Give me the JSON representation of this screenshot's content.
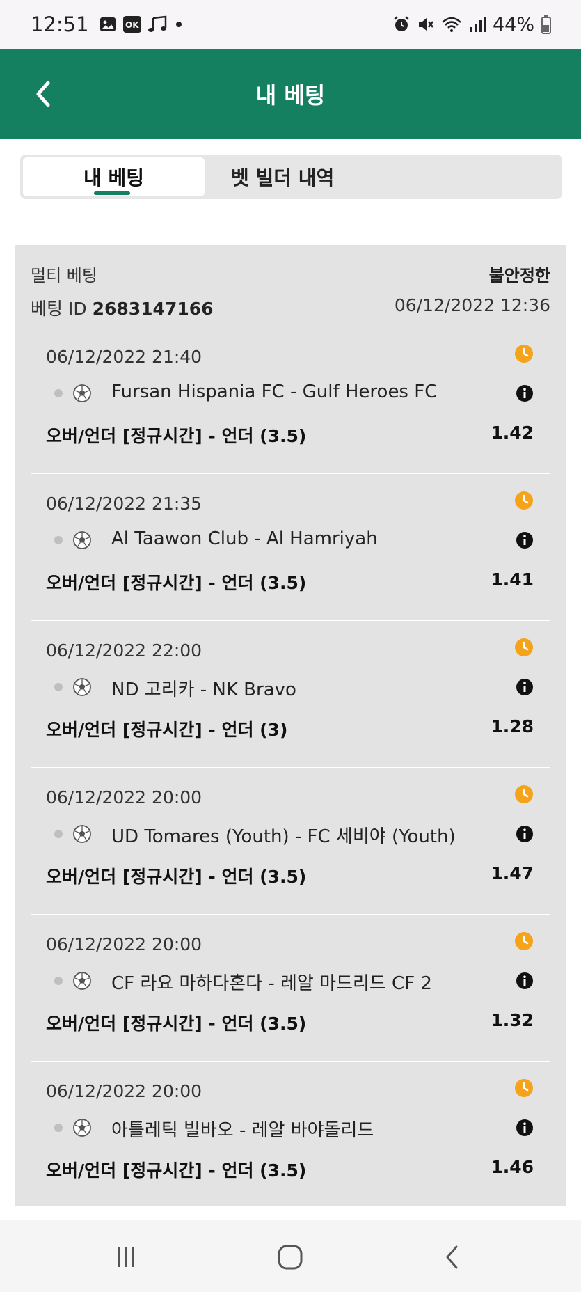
{
  "status_bar": {
    "time": "12:51",
    "left_icons": [
      "image-icon",
      "ok-app-icon",
      "music-icon",
      "dot-icon"
    ],
    "right_icons": [
      "alarm-icon",
      "mute-icon",
      "wifi-icon",
      "signal-icon",
      "battery-icon"
    ],
    "battery": "44%"
  },
  "header": {
    "title": "내 베팅",
    "back_icon": "chevron-left-icon"
  },
  "tabs": [
    {
      "label": "내 베팅",
      "active": true
    },
    {
      "label": "벳 빌더 내역",
      "active": false
    }
  ],
  "bet": {
    "type": "멀티 베팅",
    "status": "불안정한",
    "id_label": "베팅 ID",
    "id": "2683147166",
    "placed_at": "06/12/2022 12:36",
    "selections": [
      {
        "date": "06/12/2022 21:40",
        "match": "Fursan Hispania FC - Gulf Heroes FC",
        "market": "오버/언더 [정규시간] - 언더 (3.5)",
        "odds": "1.42"
      },
      {
        "date": "06/12/2022 21:35",
        "match": "Al Taawon Club - Al Hamriyah",
        "market": "오버/언더 [정규시간] - 언더 (3.5)",
        "odds": "1.41"
      },
      {
        "date": "06/12/2022 22:00",
        "match": "ND 고리카 - NK Bravo",
        "market": "오버/언더 [정규시간] - 언더 (3)",
        "odds": "1.28"
      },
      {
        "date": "06/12/2022 20:00",
        "match": "UD Tomares (Youth) - FC 세비야 (Youth)",
        "market": "오버/언더 [정규시간] - 언더 (3.5)",
        "odds": "1.47"
      },
      {
        "date": "06/12/2022 20:00",
        "match": "CF 라요 마하다혼다 - 레알 마드리드 CF 2",
        "market": "오버/언더 [정규시간] - 언더 (3.5)",
        "odds": "1.32"
      },
      {
        "date": "06/12/2022 20:00",
        "match": "아틀레틱 빌바오 - 레알 바야돌리드",
        "market": "오버/언더 [정규시간] - 언더 (3.5)",
        "odds": "1.46"
      }
    ]
  },
  "nav": {
    "icons": [
      "recent-apps-icon",
      "home-icon",
      "back-icon"
    ]
  },
  "colors": {
    "brand": "#158060",
    "pending": "#f5a31a",
    "card": "#e3e3e3"
  }
}
